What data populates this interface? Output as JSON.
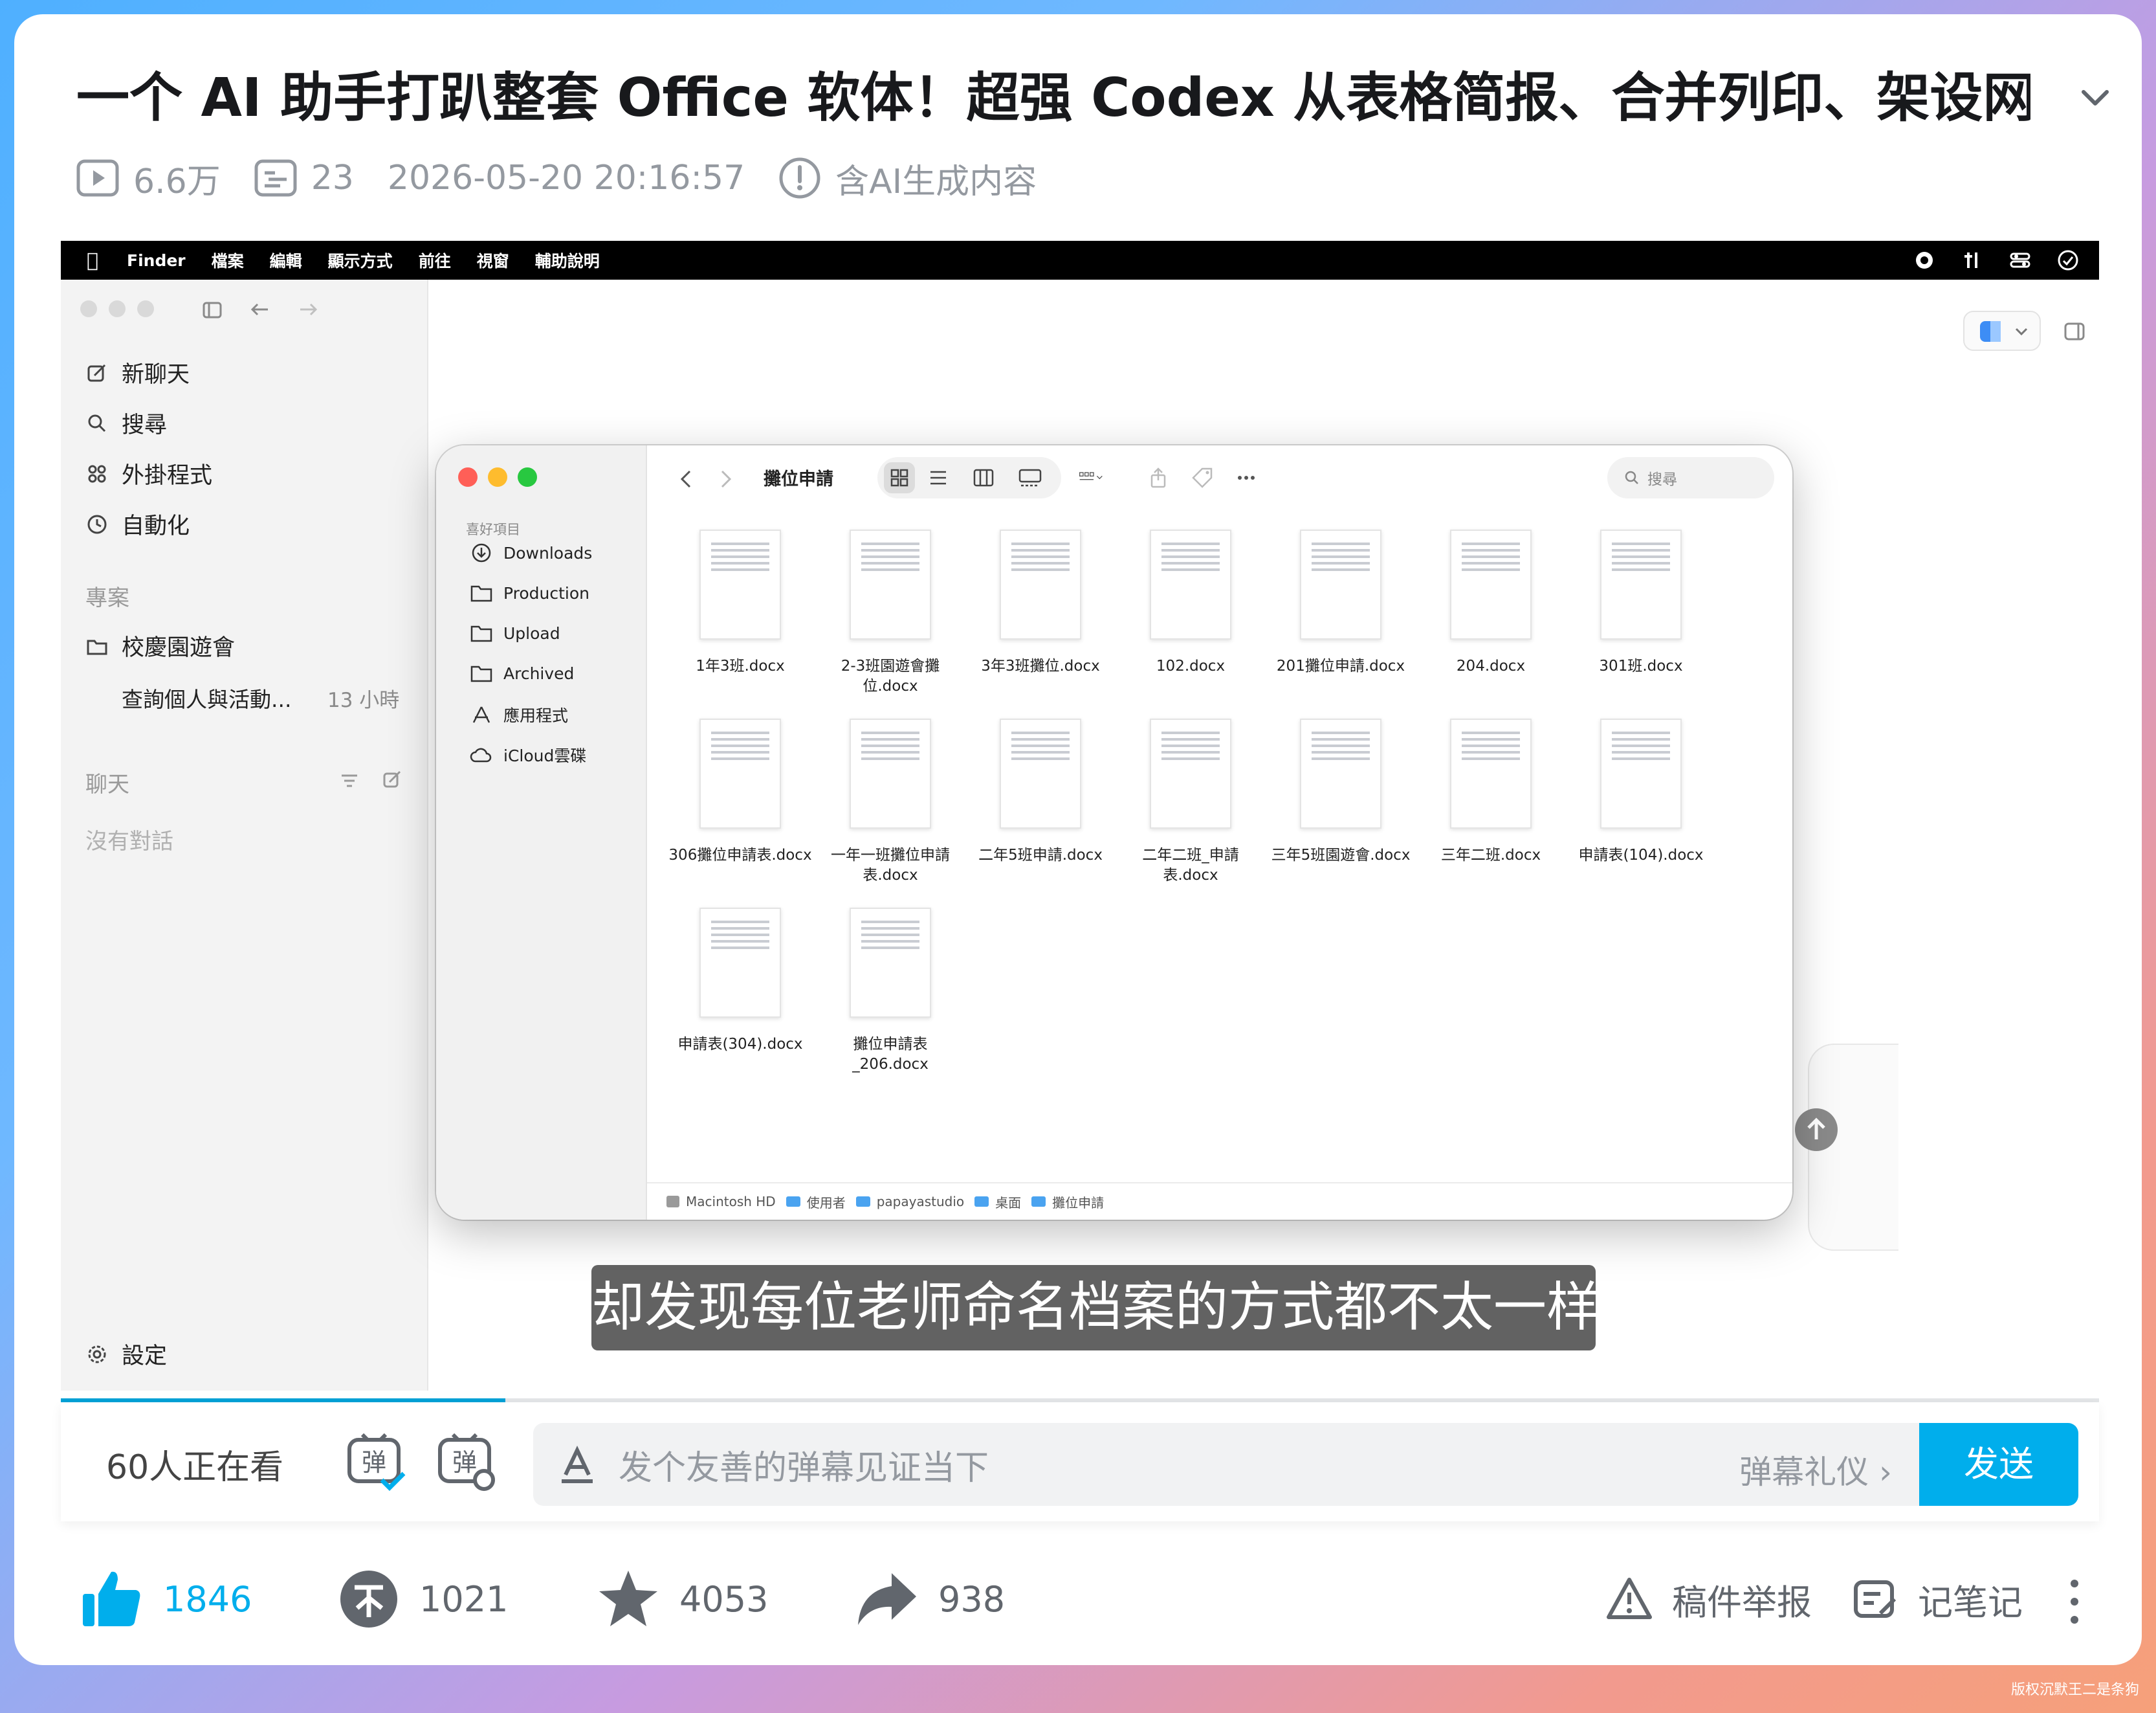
{
  "video_title": "一个 AI 助手打趴整套 Office 软体！超强 Codex 从表格简报、合并列印、架设网站...",
  "meta": {
    "views": "6.6万",
    "danmaku_count": "23",
    "datetime": "2026-05-20 20:16:57",
    "ai_notice": "含AI生成内容"
  },
  "mac_menubar": [
    "Finder",
    "檔案",
    "編輯",
    "顯示方式",
    "前往",
    "視窗",
    "輔助說明"
  ],
  "app_sidebar": {
    "items": [
      "新聊天",
      "搜尋",
      "外掛程式",
      "自動化"
    ],
    "projects_label": "專案",
    "project_name": "校慶園遊會",
    "project_thread": "查詢個人與活動...",
    "project_thread_time": "13 小時",
    "chats_label": "聊天",
    "no_chats": "沒有對話",
    "settings": "設定"
  },
  "finder": {
    "favorites_label": "喜好項目",
    "sidebar": [
      "Downloads",
      "Production",
      "Upload",
      "Archived",
      "應用程式",
      "iCloud雲碟"
    ],
    "folder_title": "攤位申請",
    "search_placeholder": "搜尋",
    "files": [
      "1年3班.docx",
      "2-3班園遊會攤位.docx",
      "3年3班攤位.docx",
      "102.docx",
      "201攤位申請.docx",
      "204.docx",
      "301班.docx",
      "306攤位申請表.docx",
      "一年一班攤位申請表.docx",
      "二年5班申請.docx",
      "二年二班_申請表.docx",
      "三年5班園遊會.docx",
      "三年二班.docx",
      "申請表(104).docx",
      "申請表(304).docx",
      "攤位申請表_206.docx"
    ],
    "path": [
      "Macintosh HD",
      "使用者",
      "papayastudio",
      "桌面",
      "攤位申請"
    ]
  },
  "subtitle": "却发现每位老师命名档案的方式都不太一样",
  "player": {
    "progress_fraction": 0.218
  },
  "danmaku_bar": {
    "watching": "60人正在看",
    "input_placeholder": "发个友善的弹幕见证当下",
    "etiquette": "弹幕礼仪",
    "send": "发送"
  },
  "actions": {
    "likes": "1846",
    "coins": "1021",
    "favorites": "4053",
    "shares": "938",
    "report": "稿件举报",
    "notes": "记笔记"
  },
  "watermark": "版权沉默王二是条狗",
  "colors": {
    "accent": "#00aeec",
    "like": "#00aeec",
    "progress": "#00a1d6"
  }
}
